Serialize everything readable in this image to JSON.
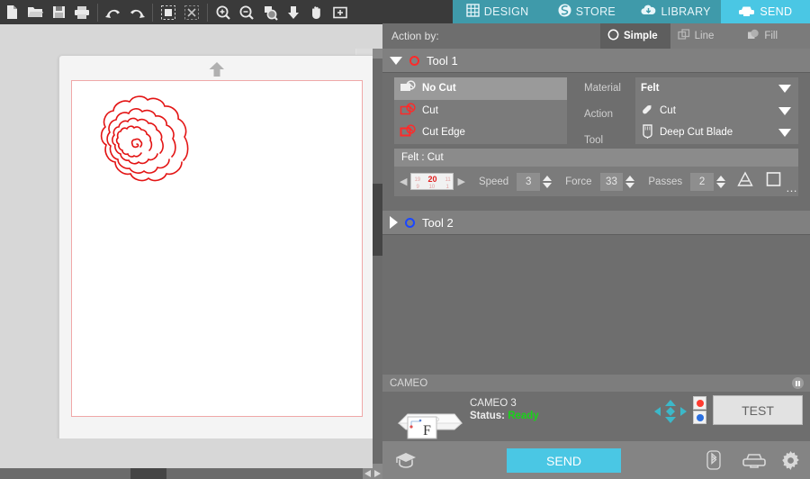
{
  "toolbar": {
    "items": [
      {
        "name": "new-document-icon",
        "label": "New"
      },
      {
        "name": "open-folder-icon",
        "label": "Open"
      },
      {
        "name": "save-icon",
        "label": "Save"
      },
      {
        "name": "print-icon",
        "label": "Print"
      },
      {
        "name": "undo-icon",
        "label": "Undo"
      },
      {
        "name": "redo-icon",
        "label": "Redo"
      },
      {
        "name": "select-all-icon",
        "label": "Select All"
      },
      {
        "name": "deselect-all-icon",
        "label": "Deselect All"
      },
      {
        "name": "zoom-in-icon",
        "label": "Zoom In"
      },
      {
        "name": "zoom-out-icon",
        "label": "Zoom Out"
      },
      {
        "name": "zoom-selection-icon",
        "label": "Zoom to Selection"
      },
      {
        "name": "fit-to-page-icon",
        "label": "Fit to Page"
      },
      {
        "name": "pan-hand-icon",
        "label": "Pan"
      },
      {
        "name": "fit-to-window-icon",
        "label": "Fit to Window"
      }
    ]
  },
  "nav": {
    "tabs": [
      {
        "label": "DESIGN",
        "icon": "grid-icon",
        "active": false
      },
      {
        "label": "STORE",
        "icon": "store-icon",
        "active": false
      },
      {
        "label": "LIBRARY",
        "icon": "cloud-download-icon",
        "active": false
      },
      {
        "label": "SEND",
        "icon": "cutter-icon",
        "active": true
      }
    ],
    "active_color": "#4ac7e4",
    "inactive_color": "#3f9aaa"
  },
  "action_bar": {
    "label": "Action by:",
    "tabs": [
      {
        "label": "Simple",
        "icon": "circle-outline-icon",
        "active": true
      },
      {
        "label": "Line",
        "icon": "line-layers-icon",
        "active": false
      },
      {
        "label": "Fill",
        "icon": "fill-layers-icon",
        "active": false
      }
    ]
  },
  "tool1": {
    "title": "Tool 1",
    "expanded": true,
    "marker_color": "#ff2a2a",
    "cut_modes": [
      {
        "label": "No Cut",
        "selected": true
      },
      {
        "label": "Cut",
        "selected": false
      },
      {
        "label": "Cut Edge",
        "selected": false
      }
    ],
    "fields": [
      {
        "label": "Material",
        "value": "Felt",
        "icon": null
      },
      {
        "label": "Action",
        "value": "Cut",
        "icon": "blade-icon"
      },
      {
        "label": "Tool",
        "value": "Deep Cut Blade",
        "icon": "deep-cut-blade-icon"
      }
    ],
    "settings": {
      "title": "Felt : Cut",
      "blade_depth": {
        "selected": "20",
        "top_row": [
          "19",
          "20",
          "11"
        ],
        "bottom_row": [
          "9",
          "10",
          "1"
        ]
      },
      "speed": {
        "label": "Speed",
        "value": "3"
      },
      "force": {
        "label": "Force",
        "value": "33"
      },
      "passes": {
        "label": "Passes",
        "value": "2"
      },
      "extra_icons": [
        "triangle-tool-icon",
        "square-tool-icon",
        "more-options-icon"
      ]
    }
  },
  "tool2": {
    "title": "Tool 2",
    "expanded": false,
    "marker_color": "#1a47ff"
  },
  "machine": {
    "panel_title": "CAMEO",
    "name": "CAMEO 3",
    "status_label": "Status:",
    "status_value": "Ready",
    "status_color": "#19d219",
    "test_button": "TEST",
    "device_icon": "cameo-cutter-icon",
    "dpad_icon": "dpad-arrows-icon",
    "led_red": "#ff3b30",
    "led_blue": "#2a6fe0",
    "pause_icon": "pause-icon"
  },
  "send_bar": {
    "send_label": "SEND",
    "send_color": "#4ac7e4",
    "icons": [
      {
        "name": "graduation-cap-icon",
        "label": "Tutorials"
      },
      {
        "name": "bluetooth-icon",
        "label": "Bluetooth"
      },
      {
        "name": "machine-icon",
        "label": "Machine"
      },
      {
        "name": "gear-icon",
        "label": "Settings"
      }
    ]
  },
  "canvas": {
    "design_name": "scalloped-spiral",
    "design_color": "#e31414",
    "cut_border_color": "#f0a8a8",
    "page_arrow_icon": "feed-arrow-icon"
  }
}
